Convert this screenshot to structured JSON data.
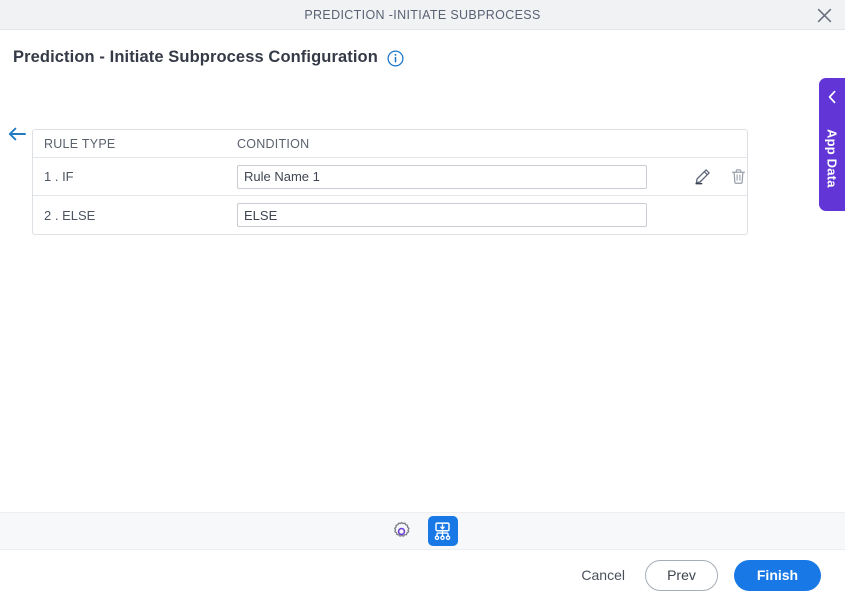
{
  "window": {
    "title": "PREDICTION -INITIATE SUBPROCESS",
    "close_icon": "close-icon"
  },
  "page": {
    "title": "Prediction - Initiate Subprocess Configuration",
    "info_icon": "info-circle-icon",
    "back_icon": "arrow-left-icon"
  },
  "table": {
    "columns": {
      "rule_type": "RULE TYPE",
      "condition": "CONDITION"
    },
    "rows": [
      {
        "rule_type": "1 . IF",
        "condition_value": "Rule Name 1",
        "condition_placeholder": "Rule Name 1",
        "edit_icon": "pencil-icon",
        "delete_icon": "trash-icon",
        "has_actions": true
      },
      {
        "rule_type": "2 . ELSE",
        "condition_value": "ELSE",
        "condition_placeholder": "ELSE",
        "has_actions": false
      }
    ]
  },
  "app_data_tab": {
    "label": "App Data",
    "chevron_icon": "chevron-left-icon",
    "color": "#6236d6"
  },
  "toolbar": {
    "items": [
      {
        "name": "settings",
        "icon": "gear-icon",
        "active": false
      },
      {
        "name": "process-diagram",
        "icon": "hierarchy-icon",
        "active": true
      }
    ]
  },
  "footer": {
    "cancel_label": "Cancel",
    "prev_label": "Prev",
    "finish_label": "Finish",
    "primary_color": "#1878e6"
  }
}
